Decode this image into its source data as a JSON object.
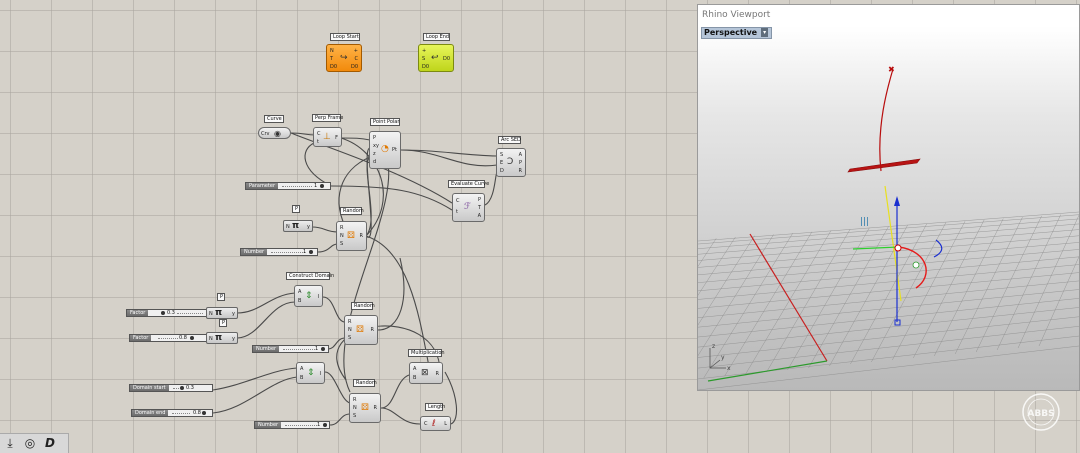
{
  "canvas": {
    "loop_start": {
      "title": "Loop Start",
      "inputs": [
        "N",
        "T",
        "D0"
      ],
      "outputs": [
        "+",
        "C",
        "D0"
      ]
    },
    "loop_end": {
      "title": "Loop End",
      "inputs": [
        "+",
        "S",
        "D0"
      ],
      "outputs": [
        "D0"
      ]
    },
    "curve": {
      "title": "Curve",
      "tag": "Crv"
    },
    "perp_frame": {
      "title": "Perp Frame",
      "inputs": [
        "C",
        "t"
      ],
      "outputs": [
        "F"
      ]
    },
    "point_polar": {
      "title": "Point Polar",
      "inputs": [
        "P",
        "xy",
        "z",
        "d"
      ],
      "outputs": [
        "Pt"
      ]
    },
    "arc_sed": {
      "title": "Arc SED",
      "inputs": [
        "S",
        "E",
        "D"
      ],
      "outputs": [
        "A",
        "P",
        "R"
      ]
    },
    "evaluate_curve": {
      "title": "Evaluate Curve",
      "inputs": [
        "C",
        "t"
      ],
      "outputs": [
        "P",
        "T",
        "A"
      ]
    },
    "pi_1": {
      "title": "Pi",
      "inputs": [
        "N"
      ],
      "outputs": [
        "y"
      ]
    },
    "random_1": {
      "title": "Random",
      "inputs": [
        "R",
        "N",
        "S"
      ],
      "outputs": [
        "R"
      ]
    },
    "construct_domain": {
      "title": "Construct Domain",
      "inputs": [
        "A",
        "B"
      ],
      "outputs": [
        "I"
      ]
    },
    "pi_2": {
      "title": "Pi",
      "inputs": [
        "N"
      ],
      "outputs": [
        "y"
      ]
    },
    "pi_3": {
      "title": "Pi",
      "inputs": [
        "N"
      ],
      "outputs": [
        "y"
      ]
    },
    "random_2": {
      "title": "Random",
      "inputs": [
        "R",
        "N",
        "S"
      ],
      "outputs": [
        "R"
      ]
    },
    "construct_domain_2": {
      "inputs": [
        "A",
        "B"
      ],
      "outputs": [
        "I"
      ]
    },
    "multiplication": {
      "title": "Multiplication",
      "inputs": [
        "A",
        "B"
      ],
      "outputs": [
        "R"
      ]
    },
    "random_3": {
      "title": "Random",
      "inputs": [
        "R",
        "N",
        "S"
      ],
      "outputs": [
        "R"
      ]
    },
    "length": {
      "title": "Length",
      "inputs": [
        "C"
      ],
      "outputs": [
        "L"
      ]
    },
    "sliders": [
      {
        "label": "Parameter",
        "value": "1",
        "fraction": 1.0
      },
      {
        "label": "Number",
        "value": "1",
        "fraction": 1.0
      },
      {
        "label": "Factor",
        "value": "0.3",
        "fraction": 0.3
      },
      {
        "label": "Factor",
        "value": "0.8",
        "fraction": 0.8
      },
      {
        "label": "Number",
        "value": "1",
        "fraction": 1.0
      },
      {
        "label": "Domain start",
        "value": "0.3",
        "fraction": 0.3
      },
      {
        "label": "Domain end",
        "value": "0.8",
        "fraction": 0.8
      },
      {
        "label": "Number",
        "value": "1",
        "fraction": 1.0
      }
    ],
    "pi_tags": [
      "P",
      "P",
      "P"
    ]
  },
  "viewport": {
    "title": "Rhino Viewport",
    "view_name": "Perspective",
    "dropdown_glyph": "▾",
    "axis_labels": {
      "x": "x",
      "y": "y",
      "z": "z"
    },
    "colors": {
      "grid": "#8a8a8a",
      "x_axis": "#c82020",
      "y_axis": "#2c9a2c",
      "curve": "#b80d0d",
      "highlight_plane": "#b81414",
      "arc": "#e51b1b",
      "z_gizmo": "#1a2fd0",
      "yellow_line": "#e8e020"
    }
  },
  "toolbar": {
    "icons": [
      "bake-icon",
      "preview-icon",
      "document-icon"
    ]
  },
  "watermark": {
    "text": "ABBS"
  }
}
